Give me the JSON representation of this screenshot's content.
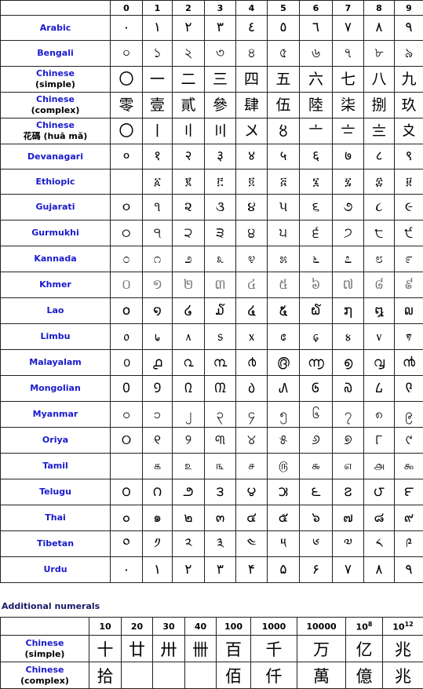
{
  "main_table": {
    "headers": [
      "",
      "0",
      "1",
      "2",
      "3",
      "4",
      "5",
      "6",
      "7",
      "8",
      "9"
    ],
    "rows": [
      {
        "name": "Arabic",
        "sub": "",
        "digits": [
          "٠",
          "١",
          "٢",
          "٣",
          "٤",
          "٥",
          "٦",
          "٧",
          "٨",
          "٩"
        ]
      },
      {
        "name": "Bengali",
        "sub": "",
        "digits": [
          "০",
          "১",
          "২",
          "৩",
          "৪",
          "৫",
          "৬",
          "৭",
          "৮",
          "৯"
        ]
      },
      {
        "name": "Chinese",
        "sub": "(simple)",
        "digits": [
          "〇",
          "一",
          "二",
          "三",
          "四",
          "五",
          "六",
          "七",
          "八",
          "九"
        ]
      },
      {
        "name": "Chinese",
        "sub": "(complex)",
        "digits": [
          "零",
          "壹",
          "貳",
          "參",
          "肆",
          "伍",
          "陸",
          "柒",
          "捌",
          "玖"
        ]
      },
      {
        "name": "Chinese",
        "sub": "花碼 (huā mǎ)",
        "digits": [
          "〇",
          "〡",
          "〢",
          "〣",
          "〤",
          "〥",
          "〦",
          "〧",
          "〨",
          "〩"
        ]
      },
      {
        "name": "Devanagari",
        "sub": "",
        "digits": [
          "०",
          "१",
          "२",
          "३",
          "४",
          "५",
          "६",
          "७",
          "८",
          "९"
        ]
      },
      {
        "name": "Ethiopic",
        "sub": "",
        "digits": [
          "",
          "፩",
          "፪",
          "፫",
          "፬",
          "፭",
          "፮",
          "፯",
          "፰",
          "፱"
        ]
      },
      {
        "name": "Gujarati",
        "sub": "",
        "digits": [
          "૦",
          "૧",
          "૨",
          "૩",
          "૪",
          "૫",
          "૬",
          "૭",
          "૮",
          "૯"
        ]
      },
      {
        "name": "Gurmukhi",
        "sub": "",
        "digits": [
          "੦",
          "੧",
          "੨",
          "੩",
          "੪",
          "੫",
          "੬",
          "੭",
          "੮",
          "੯"
        ]
      },
      {
        "name": "Kannada",
        "sub": "",
        "digits": [
          "೦",
          "೧",
          "೨",
          "೩",
          "೪",
          "೫",
          "೬",
          "೭",
          "೮",
          "೯"
        ]
      },
      {
        "name": "Khmer",
        "sub": "",
        "digits": [
          "០",
          "១",
          "២",
          "៣",
          "៤",
          "៥",
          "៦",
          "៧",
          "៨",
          "៩"
        ]
      },
      {
        "name": "Lao",
        "sub": "",
        "digits": [
          "໐",
          "໑",
          "໒",
          "໓",
          "໔",
          "໕",
          "໖",
          "໗",
          "໘",
          "໙"
        ]
      },
      {
        "name": "Limbu",
        "sub": "",
        "digits": [
          "᥆",
          "᥇",
          "᥈",
          "᥉",
          "᥊",
          "᥋",
          "᥌",
          "᥍",
          "᥎",
          "᥏"
        ]
      },
      {
        "name": "Malayalam",
        "sub": "",
        "digits": [
          "൦",
          "൧",
          "൨",
          "൩",
          "൪",
          "൫",
          "൬",
          "൭",
          "൮",
          "൯"
        ]
      },
      {
        "name": "Mongolian",
        "sub": "",
        "digits": [
          "᠐",
          "᠑",
          "᠒",
          "᠓",
          "᠔",
          "᠕",
          "᠖",
          "᠗",
          "᠘",
          "᠙"
        ]
      },
      {
        "name": "Myanmar",
        "sub": "",
        "digits": [
          "၀",
          "၁",
          "၂",
          "၃",
          "၄",
          "၅",
          "၆",
          "၇",
          "၈",
          "၉"
        ]
      },
      {
        "name": "Oriya",
        "sub": "",
        "digits": [
          "୦",
          "୧",
          "୨",
          "୩",
          "୪",
          "୫",
          "୬",
          "୭",
          "୮",
          "୯"
        ]
      },
      {
        "name": "Tamil",
        "sub": "",
        "digits": [
          "",
          "௧",
          "௨",
          "௩",
          "௪",
          "௫",
          "௬",
          "௭",
          "௮",
          "௯"
        ]
      },
      {
        "name": "Telugu",
        "sub": "",
        "digits": [
          "౦",
          "౧",
          "౨",
          "౩",
          "౪",
          "౫",
          "౬",
          "౭",
          "౮",
          "౯"
        ]
      },
      {
        "name": "Thai",
        "sub": "",
        "digits": [
          "๐",
          "๑",
          "๒",
          "๓",
          "๔",
          "๕",
          "๖",
          "๗",
          "๘",
          "๙"
        ]
      },
      {
        "name": "Tibetan",
        "sub": "",
        "digits": [
          "༠",
          "༡",
          "༢",
          "༣",
          "༤",
          "༥",
          "༦",
          "༧",
          "༨",
          "༩"
        ]
      },
      {
        "name": "Urdu",
        "sub": "",
        "digits": [
          "۰",
          "۱",
          "۲",
          "۳",
          "۴",
          "۵",
          "۶",
          "۷",
          "۸",
          "۹"
        ]
      }
    ]
  },
  "additional": {
    "title": "Additional numerals",
    "headers": [
      {
        "base": "",
        "exp": ""
      },
      {
        "base": "10",
        "exp": ""
      },
      {
        "base": "20",
        "exp": ""
      },
      {
        "base": "30",
        "exp": ""
      },
      {
        "base": "40",
        "exp": ""
      },
      {
        "base": "100",
        "exp": ""
      },
      {
        "base": "1000",
        "exp": ""
      },
      {
        "base": "10000",
        "exp": ""
      },
      {
        "base": "10",
        "exp": "8"
      },
      {
        "base": "10",
        "exp": "12"
      }
    ],
    "rows": [
      {
        "name": "Chinese",
        "sub": "(simple)",
        "values": [
          "十",
          "廿",
          "卅",
          "卌",
          "百",
          "千",
          "万",
          "亿",
          "兆"
        ]
      },
      {
        "name": "Chinese",
        "sub": "(complex)",
        "values": [
          "拾",
          "",
          "",
          "",
          "佰",
          "仟",
          "萬",
          "億",
          "兆"
        ]
      }
    ]
  }
}
